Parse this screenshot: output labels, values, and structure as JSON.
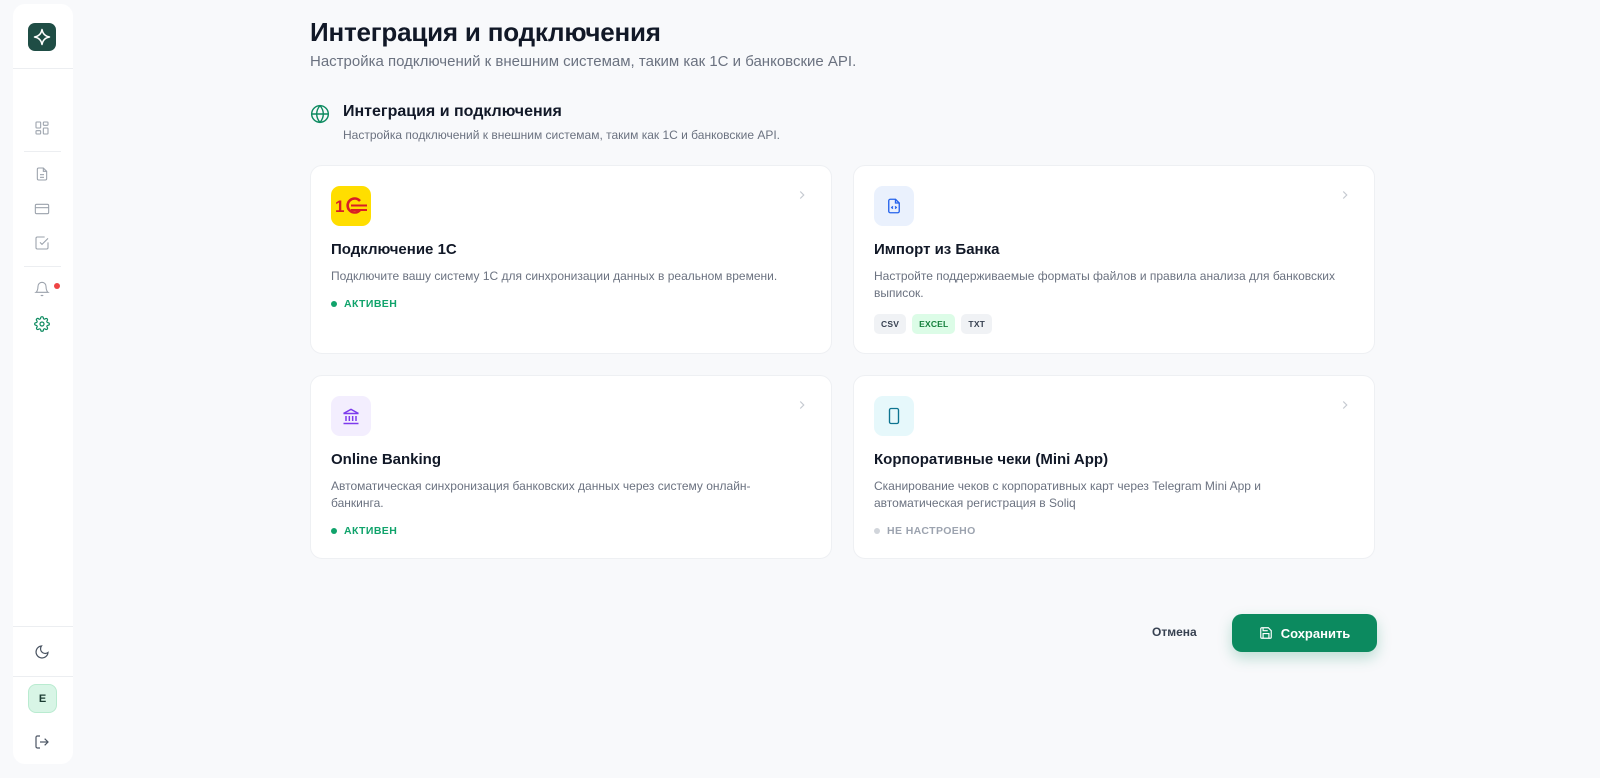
{
  "sidebar": {
    "items": [
      {
        "icon": "dashboard-icon"
      },
      {
        "icon": "document-icon"
      },
      {
        "icon": "credit-card-icon"
      },
      {
        "icon": "checkbox-icon"
      },
      {
        "icon": "bell-icon",
        "has_notification": true
      },
      {
        "icon": "gear-icon",
        "active": true
      }
    ],
    "theme_icon": "moon-icon",
    "avatar_initial": "E",
    "logout_icon": "logout-icon"
  },
  "page": {
    "title": "Интеграция и подключения",
    "subtitle": "Настройка подключений к внешним системам, таким как 1С и банковские API."
  },
  "section": {
    "icon": "globe-icon",
    "title": "Интеграция и подключения",
    "subtitle": "Настройка подключений к внешним системам, таким как 1С и банковские API."
  },
  "cards": [
    {
      "title": "Подключение 1С",
      "description": "Подключите вашу систему 1С для синхронизации данных в реальном времени.",
      "status": "АКТИВЕН",
      "icon": "1c-logo-icon"
    },
    {
      "title": "Импорт из Банка",
      "description": "Настройте поддерживаемые форматы файлов и правила анализа для банковских выписок.",
      "tags": [
        "CSV",
        "EXCEL",
        "TXT"
      ],
      "icon": "file-code-icon"
    },
    {
      "title": "Online Banking",
      "description": "Автоматическая синхронизация банковских данных через систему онлайн-банкинга.",
      "status": "АКТИВЕН",
      "icon": "bank-icon"
    },
    {
      "title": "Корпоративные чеки (Mini App)",
      "description": "Сканирование чеков с корпоративных карт через Telegram Mini App и автоматическая регистрация в Soliq",
      "status": "НЕ НАСТРОЕНО",
      "icon": "tablet-icon"
    }
  ],
  "actions": {
    "cancel_label": "Отмена",
    "save_label": "Сохранить"
  },
  "colors": {
    "accent": "#0c8a5f",
    "active_status": "#10a36b",
    "inactive_status": "#9ca3af",
    "notification": "#ef4444"
  }
}
